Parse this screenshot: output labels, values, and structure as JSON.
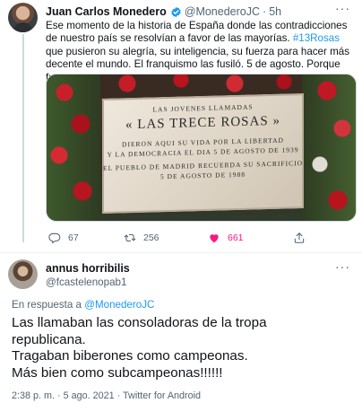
{
  "tweet": {
    "author_name": "Juan Carlos Monedero",
    "handle": "@MonederoJC",
    "separator": "·",
    "time": "5h",
    "text_before": "Ese momento de la historia de España donde las contradicciones de nuestro país se resolvían a favor de las mayorías. ",
    "hashtag": "#13Rosas",
    "text_after": " que pusieron su alegría, su inteligencia, su fuerza para hacer más decente el mundo. El franquismo las fusiló. 5 de agosto. Porque fueron somos.",
    "plaque": {
      "line1": "LAS JOVENES LLAMADAS",
      "line2": "« LAS TRECE ROSAS »",
      "line3a": "DIERON AQUI SU VIDA POR LA LIBERTAD",
      "line3b": "Y LA DEMOCRACIA EL DIA 5 DE AGOSTO DE 1939",
      "line4a": "EL PUEBLO DE MADRID RECUERDA SU SACRIFICIO",
      "line4b": "5 DE AGOSTO DE 1988"
    },
    "replies": "67",
    "retweets": "256",
    "likes": "661"
  },
  "reply": {
    "author_name": "annus horribilis",
    "handle": "@fcastelenopab1",
    "reply_prefix": "En respuesta a ",
    "reply_mention": "@MonederoJC",
    "line1": "Las llamaban las consoladoras de la tropa",
    "line2": "republicana.",
    "line3": "Tragaban biberones como campeonas.",
    "line4": "Más bien como subcampeonas!!!!!!",
    "timestamp": "2:38 p. m. · 5 ago. 2021 · Twitter for Android"
  },
  "icons": {
    "verified": "verified-badge-icon",
    "more": "more-options-icon",
    "reply": "reply-icon",
    "retweet": "retweet-icon",
    "like": "heart-icon",
    "share": "share-icon"
  },
  "colors": {
    "accent": "#1d9bf0",
    "like": "#f91880",
    "secondary_text": "#536471"
  }
}
